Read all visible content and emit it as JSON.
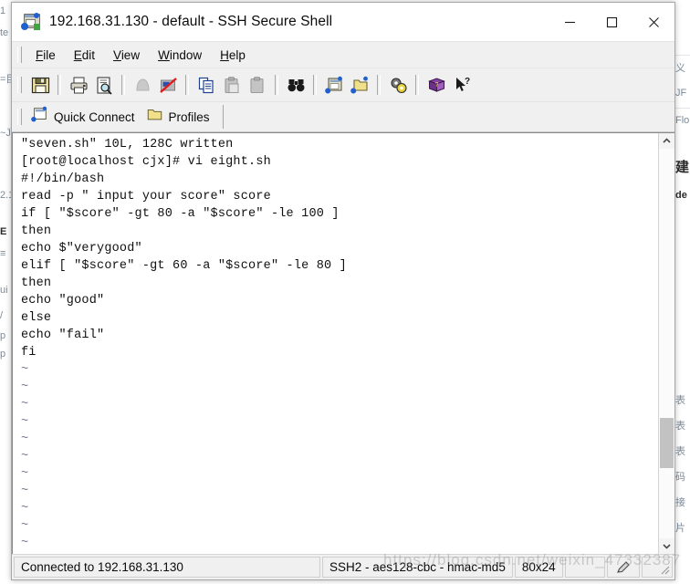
{
  "window": {
    "title": "192.168.31.130 - default - SSH Secure Shell",
    "app_icon": "ssh-terminal-icon",
    "controls": {
      "minimize": "minimize-icon",
      "maximize": "maximize-icon",
      "close": "close-icon"
    }
  },
  "menubar": {
    "items": [
      {
        "label": "File",
        "mnemonic": "F"
      },
      {
        "label": "Edit",
        "mnemonic": "E"
      },
      {
        "label": "View",
        "mnemonic": "V"
      },
      {
        "label": "Window",
        "mnemonic": "W"
      },
      {
        "label": "Help",
        "mnemonic": "H"
      }
    ]
  },
  "toolbar": {
    "buttons": [
      {
        "name": "save-icon",
        "title": "Save"
      },
      {
        "name": "print-icon",
        "title": "Print"
      },
      {
        "name": "print-preview-icon",
        "title": "Print Preview"
      },
      {
        "name": "connect-icon",
        "title": "Connect"
      },
      {
        "name": "disconnect-icon",
        "title": "Disconnect"
      },
      {
        "name": "copy-icon",
        "title": "Copy"
      },
      {
        "name": "paste-icon",
        "title": "Paste"
      },
      {
        "name": "paste-clipboard-icon",
        "title": "Paste"
      },
      {
        "name": "find-icon",
        "title": "Find"
      },
      {
        "name": "new-terminal-icon",
        "title": "New Terminal Window"
      },
      {
        "name": "new-transfer-icon",
        "title": "New File Transfer Window"
      },
      {
        "name": "settings-icon",
        "title": "Settings"
      },
      {
        "name": "help-book-icon",
        "title": "Help"
      },
      {
        "name": "context-help-icon",
        "title": "Context Help"
      }
    ]
  },
  "connectbar": {
    "quick_connect": {
      "label": "Quick Connect",
      "icon": "quick-connect-icon"
    },
    "profiles": {
      "label": "Profiles",
      "icon": "profiles-folder-icon"
    }
  },
  "terminal": {
    "lines": [
      "\"seven.sh\" 10L, 128C written",
      "[root@localhost cjx]# vi eight.sh",
      "#!/bin/bash",
      "read -p \" input your score\" score",
      "if [ \"$score\" -gt 80 -a \"$score\" -le 100 ]",
      "then",
      "echo $\"verygood\"",
      "elif [ \"$score\" -gt 60 -a \"$score\" -le 80 ]",
      "then",
      "echo \"good\"",
      "else",
      "echo \"fail\"",
      "fi"
    ],
    "empty_markers": [
      "~",
      "~",
      "~",
      "~",
      "~",
      "~",
      "~",
      "~",
      "~",
      "~",
      "~"
    ],
    "background": "#ffffff",
    "foreground": "#101010"
  },
  "scrollbar": {
    "up_arrow": "chevron-up-icon",
    "down_arrow": "chevron-down-icon",
    "thumb_position_pct": 69,
    "thumb_size_pct": 13
  },
  "statusbar": {
    "connection": "Connected to 192.168.31.130",
    "cipher": "SSH2 - aes128-cbc - hmac-md5",
    "size": "80x24",
    "edit_icon": "pencil-edit-icon",
    "resize_grip": "resize-grip-icon"
  },
  "watermark": {
    "text": "https://blog.csdn.net/weixin_47332387"
  },
  "background_page": {
    "right_fragments": [
      "义",
      "JF",
      "Flo",
      "建",
      "de",
      "表",
      "表",
      "表",
      "码",
      "接",
      "片"
    ],
    "left_fragments": [
      "1",
      "te",
      "=目",
      "~Ĵ",
      "2.1",
      "E",
      "≡",
      "ui",
      "/",
      "p",
      "p"
    ]
  },
  "colors": {
    "titlebar_bg": "#ffffff",
    "chrome_bg": "#f0f0f0",
    "terminal_bg": "#ffffff",
    "accent_blue": "#1f5fd0",
    "warn_red": "#e01b1b",
    "folder_yellow": "#f0e08a"
  }
}
